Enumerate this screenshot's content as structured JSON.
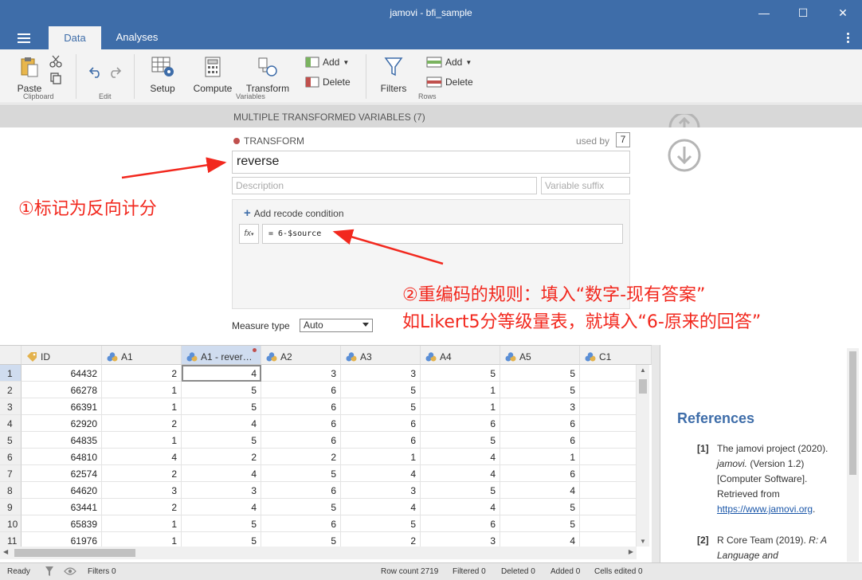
{
  "window": {
    "title": "jamovi - bfi_sample"
  },
  "menubar": {
    "tabs": [
      "Data",
      "Analyses"
    ]
  },
  "ribbon": {
    "clipboard": {
      "paste": "Paste",
      "group": "Clipboard"
    },
    "edit": {
      "group": "Edit"
    },
    "variables": {
      "setup": "Setup",
      "compute": "Compute",
      "transform": "Transform",
      "add": "Add",
      "delete": "Delete",
      "group": "Variables"
    },
    "rows": {
      "filters": "Filters",
      "add": "Add",
      "delete": "Delete",
      "group": "Rows"
    }
  },
  "variables_header": "MULTIPLE TRANSFORMED VARIABLES (7)",
  "transform": {
    "label": "TRANSFORM",
    "used_by_label": "used by",
    "used_by_count": "7",
    "name": "reverse",
    "description_placeholder": "Description",
    "suffix_placeholder": "Variable suffix",
    "add_recode": "Add recode condition",
    "fx": "fx",
    "formula": "= 6-$source",
    "measure_label": "Measure type",
    "measure_value": "Auto"
  },
  "annotations": {
    "note1": "①标记为反向计分",
    "note2_line1": "②重编码的规则：填入“数字-现有答案”",
    "note2_line2": "如Likert5分等级量表，就填入“6-原来的回答”"
  },
  "grid": {
    "columns": [
      "ID",
      "A1",
      "A1 - rever…",
      "A2",
      "A3",
      "A4",
      "A5",
      "C1"
    ],
    "rows": [
      {
        "n": "1",
        "cells": [
          "64432",
          "2",
          "4",
          "3",
          "3",
          "5",
          "5",
          ""
        ]
      },
      {
        "n": "2",
        "cells": [
          "66278",
          "1",
          "5",
          "6",
          "5",
          "1",
          "5",
          ""
        ]
      },
      {
        "n": "3",
        "cells": [
          "66391",
          "1",
          "5",
          "6",
          "5",
          "1",
          "3",
          ""
        ]
      },
      {
        "n": "4",
        "cells": [
          "62920",
          "2",
          "4",
          "6",
          "6",
          "6",
          "6",
          ""
        ]
      },
      {
        "n": "5",
        "cells": [
          "64835",
          "1",
          "5",
          "6",
          "6",
          "5",
          "6",
          ""
        ]
      },
      {
        "n": "6",
        "cells": [
          "64810",
          "4",
          "2",
          "2",
          "1",
          "4",
          "1",
          ""
        ]
      },
      {
        "n": "7",
        "cells": [
          "62574",
          "2",
          "4",
          "5",
          "4",
          "4",
          "6",
          ""
        ]
      },
      {
        "n": "8",
        "cells": [
          "64620",
          "3",
          "3",
          "6",
          "3",
          "5",
          "4",
          ""
        ]
      },
      {
        "n": "9",
        "cells": [
          "63441",
          "2",
          "4",
          "5",
          "4",
          "4",
          "5",
          ""
        ]
      },
      {
        "n": "10",
        "cells": [
          "65839",
          "1",
          "5",
          "6",
          "5",
          "6",
          "5",
          ""
        ]
      },
      {
        "n": "11",
        "cells": [
          "61976",
          "1",
          "5",
          "5",
          "2",
          "3",
          "4",
          ""
        ]
      }
    ]
  },
  "results": {
    "title": "References",
    "ref1": {
      "num": "[1]",
      "text1": "The jamovi project (2020).",
      "italic": "jamovi.",
      "text2": " (Version 1.2) [Computer Software]. Retrieved from ",
      "link": "https://www.jamovi.org",
      "end": "."
    },
    "ref2": {
      "num": "[2]",
      "text1": "R Core Team (2019). ",
      "italic": "R: A Language and"
    }
  },
  "status": {
    "ready": "Ready",
    "filters": "Filters 0",
    "row_count": "Row count 2719",
    "filtered": "Filtered 0",
    "deleted": "Deleted 0",
    "added": "Added 0",
    "cells_edited": "Cells edited 0"
  },
  "colors": {
    "brand": "#3e6da9",
    "annotation": "#f2281e",
    "nominal_icon": "#5b8fd6",
    "id_icon": "#e3b24d"
  }
}
